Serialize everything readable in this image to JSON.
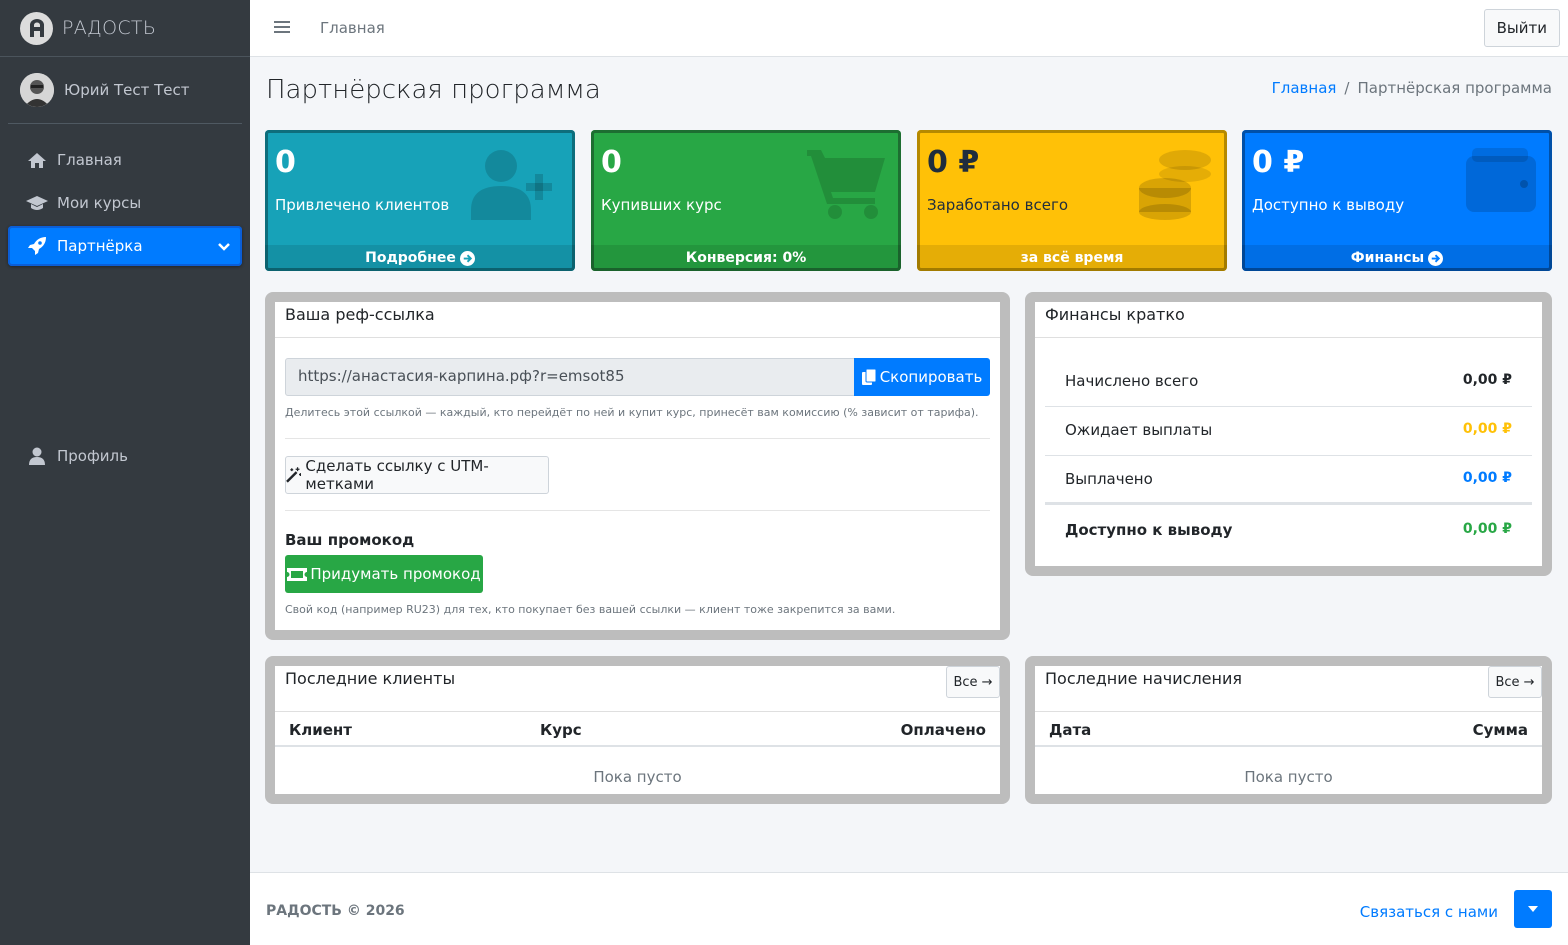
{
  "brand": {
    "name": "РАДОСТЬ"
  },
  "user": {
    "name": "Юрий Тест Тест"
  },
  "sidebar": {
    "items": [
      {
        "label": "Главная",
        "icon": "home-icon"
      },
      {
        "label": "Мои курсы",
        "icon": "graduation-cap-icon"
      },
      {
        "label": "Партнёрка",
        "icon": "rocket-icon",
        "active": true
      },
      {
        "label": "Профиль",
        "icon": "user-icon"
      }
    ]
  },
  "header": {
    "home_link": "Главная",
    "logout_label": "Выйти"
  },
  "page": {
    "title": "Партнёрская программа"
  },
  "breadcrumb": {
    "home": "Главная",
    "separator": "/",
    "current": "Партнёрская программа"
  },
  "stats": [
    {
      "value": "0",
      "label": "Привлечено клиентов",
      "footer": "Подробнее",
      "color": "#17a2b8",
      "icon": "user-plus-icon"
    },
    {
      "value": "0",
      "label": "Купивших курс",
      "footer": "Конверсия: 0%",
      "color": "#28a745",
      "icon": "cart-icon"
    },
    {
      "value": "0 ₽",
      "label": "Заработано всего",
      "footer": "за всё время",
      "color": "#ffc107",
      "icon": "coins-icon"
    },
    {
      "value": "0 ₽",
      "label": "Доступно к выводу",
      "footer": "Финансы",
      "color": "#007bff",
      "icon": "wallet-icon"
    }
  ],
  "ref": {
    "title": "Ваша реф-ссылка",
    "link": "https://анастасия-карпина.рф?r=emsot85",
    "copy_label": "Скопировать",
    "hint": "Делитесь этой ссылкой — каждый, кто перейдёт по ней и купит курс, принесёт вам комиссию (% зависит от тарифа).",
    "utm_label": "Сделать ссылку с UTM-метками",
    "promo_title": "Ваш промокод",
    "promo_button": "Придумать промокод",
    "promo_hint": "Свой код (например RU23) для тех, кто покупает без вашей ссылки — клиент тоже закрепится за вами."
  },
  "finance": {
    "title": "Финансы кратко",
    "rows": [
      {
        "label": "Начислено всего",
        "value": "0,00 ₽",
        "color": "#212529"
      },
      {
        "label": "Ожидает выплаты",
        "value": "0,00 ₽",
        "color": "#ffc107"
      },
      {
        "label": "Выплачено",
        "value": "0,00 ₽",
        "color": "#007bff"
      },
      {
        "label": "Доступно к выводу",
        "value": "0,00 ₽",
        "color": "#28a745"
      }
    ]
  },
  "clients": {
    "title": "Последние клиенты",
    "all_label": "Все →",
    "columns": [
      "Клиент",
      "Курс",
      "Оплачено"
    ],
    "empty": "Пока пусто"
  },
  "accruals": {
    "title": "Последние начисления",
    "all_label": "Все →",
    "columns": [
      "Дата",
      "Сумма"
    ],
    "empty": "Пока пусто"
  },
  "footer": {
    "copyright": "РАДОСТЬ © 2026",
    "contact": "Связаться с нами"
  }
}
